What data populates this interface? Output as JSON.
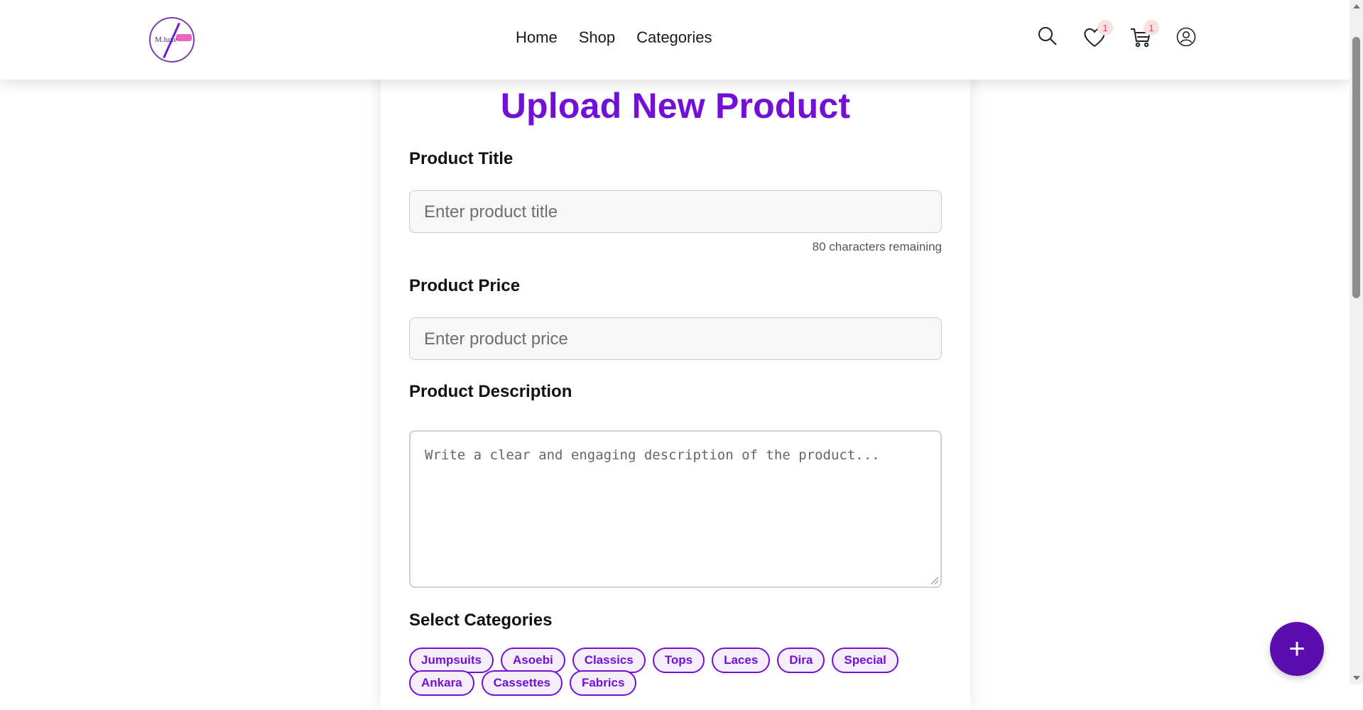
{
  "brand": {
    "logo_text": "M.luxe"
  },
  "nav": {
    "items": [
      {
        "label": "Home"
      },
      {
        "label": "Shop"
      },
      {
        "label": "Categories"
      }
    ]
  },
  "header_icons": {
    "search": "search-icon",
    "wishlist": "heart-icon",
    "wishlist_count": "1",
    "cart": "cart-icon",
    "cart_count": "1",
    "account": "user-icon"
  },
  "form": {
    "title": "Upload New Product",
    "product_title_label": "Product Title",
    "product_title_placeholder": "Enter product title",
    "characters_remaining": "80 characters remaining",
    "product_price_label": "Product Price",
    "product_price_placeholder": "Enter product price",
    "description_label": "Product Description",
    "description_placeholder": "Write a clear and engaging description of the product...",
    "categories_label": "Select Categories",
    "categories": [
      "Jumpsuits",
      "Asoebi",
      "Classics",
      "Tops",
      "Laces",
      "Dira",
      "Special",
      "Ankara",
      "Cassettes",
      "Fabrics"
    ]
  },
  "fab": {
    "label": "+"
  },
  "colors": {
    "accent": "#7410d6",
    "fab": "#5a0eb0",
    "badge_bg": "#fbe0e0",
    "badge_text": "#e23a6a"
  }
}
